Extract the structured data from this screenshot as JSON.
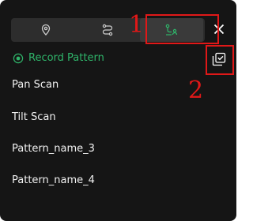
{
  "panel": {
    "tabs": [
      {
        "icon": "location-pin-icon",
        "active": false
      },
      {
        "icon": "route-icon",
        "active": false
      },
      {
        "icon": "path-user-icon",
        "active": true
      }
    ],
    "close_icon": "close-icon",
    "record_label": "Record Pattern",
    "record_icon": "record-icon",
    "select_icon": "select-checkbox-icon",
    "patterns": [
      {
        "label": "Pan Scan"
      },
      {
        "label": "Tilt Scan"
      },
      {
        "label": "Pattern_name_3"
      },
      {
        "label": "Pattern_name_4"
      }
    ]
  },
  "annotations": [
    {
      "label": "1",
      "color": "#e01818"
    },
    {
      "label": "2",
      "color": "#e01818"
    }
  ]
}
